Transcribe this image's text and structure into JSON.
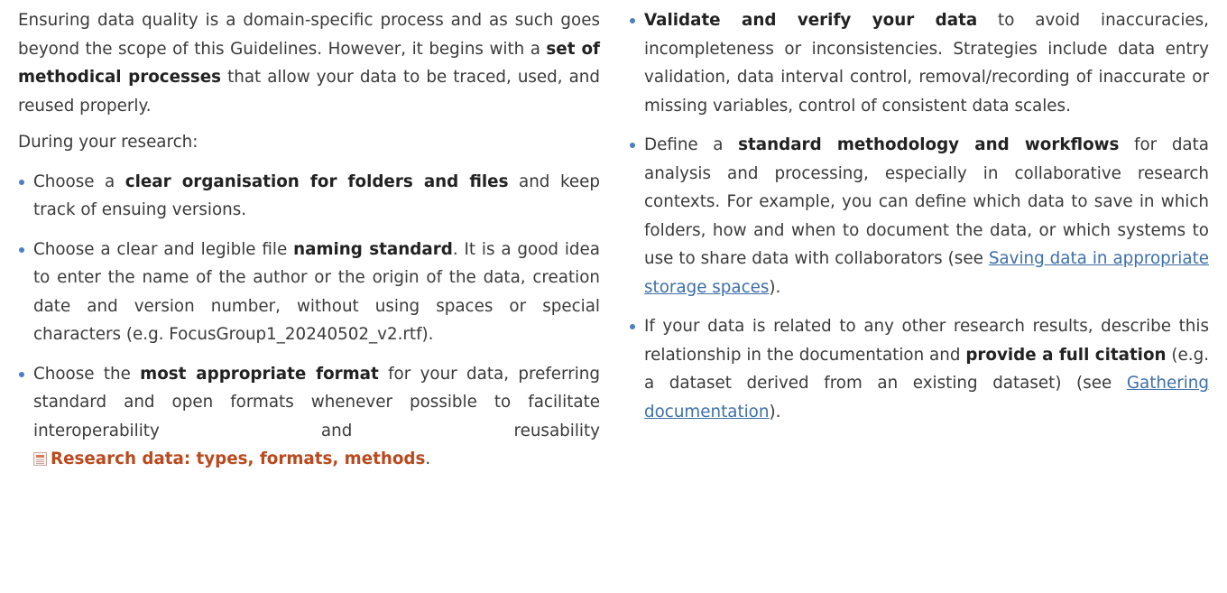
{
  "left": {
    "intro": {
      "a": "Ensuring data quality is a domain-specific process and as such goes beyond the scope of this Guidelines. However, it begins with a ",
      "b": "set of methodical processes",
      "c": " that allow your data to be traced, used, and reused properly."
    },
    "during": "During your research:",
    "items": [
      {
        "a": "Choose a ",
        "b": "clear organisation for folders and files",
        "c": " and keep track of ensuing versions."
      },
      {
        "a": "Choose a clear and legible file ",
        "b": "naming standard",
        "c": ". It is a good idea to enter the name of the author or the origin of the data, creation date and version number, without using spaces or special characters (e.g. FocusGroup1_20240502_v2.rtf)."
      },
      {
        "a": "Choose the ",
        "b": "most appropriate format",
        "c": " for your data, preferring standard and open formats whenever possible to facilitate interoperability and reusability ",
        "ref": "Research data: types, formats, methods",
        "d": "."
      }
    ]
  },
  "right": {
    "items": [
      {
        "b": "Validate and verify your data",
        "c": " to avoid inaccuracies, incompleteness or inconsistencies. Strategies include data entry validation, data interval control, removal/recording of inaccurate or missing variables, control of consistent data scales."
      },
      {
        "a": "Define a ",
        "b": "standard methodology and workflows",
        "c": " for data analysis and processing, especially in collaborative research contexts. For example, you can define which data to save in which folders, how and when to document the data, or which systems to use to share data with collaborators (see ",
        "link": "Saving data in appropriate storage spaces",
        "d": ")."
      },
      {
        "a": "If your data is related to any other research results, describe this relationship in the documentation and ",
        "b": "provide a full citation",
        "c": " (e.g. a dataset derived from an existing dataset) (see ",
        "link": "Gathering documentation",
        "d": ")."
      }
    ]
  },
  "colors": {
    "bullet": "#4a7fc0",
    "link": "#3d6fa8",
    "reference": "#b94a1f"
  }
}
